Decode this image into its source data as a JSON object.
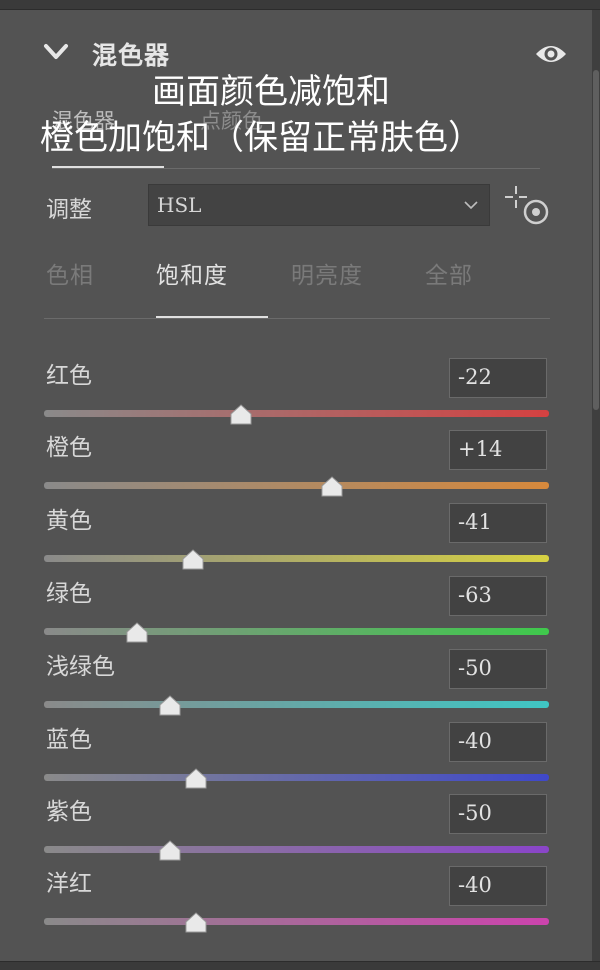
{
  "panel": {
    "title": "混色器"
  },
  "mode_tabs": {
    "mixer": "混色器",
    "point_color": "点颜色"
  },
  "overlay": {
    "line1": "画面颜色减饱和",
    "line2": "橙色加饱和（保留正常肤色）"
  },
  "adjust": {
    "label": "调整",
    "value": "HSL"
  },
  "subtabs": {
    "hue": "色相",
    "saturation": "饱和度",
    "luminance": "明亮度",
    "all": "全部"
  },
  "active_subtab": "饱和度",
  "sliders": [
    {
      "label": "红色",
      "display": "-22",
      "value": -22,
      "color": "#d44141"
    },
    {
      "label": "橙色",
      "display": "+14",
      "value": 14,
      "color": "#d7893c"
    },
    {
      "label": "黄色",
      "display": "-41",
      "value": -41,
      "color": "#d6d142"
    },
    {
      "label": "绿色",
      "display": "-63",
      "value": -63,
      "color": "#3fc94c"
    },
    {
      "label": "浅绿色",
      "display": "-50",
      "value": -50,
      "color": "#3fc6c4"
    },
    {
      "label": "蓝色",
      "display": "-40",
      "value": -40,
      "color": "#3f48c9"
    },
    {
      "label": "紫色",
      "display": "-50",
      "value": -50,
      "color": "#8a45c9"
    },
    {
      "label": "洋红",
      "display": "-40",
      "value": -40,
      "color": "#cc43ad"
    }
  ],
  "icons": [
    "chevron-down-icon",
    "eye-icon",
    "dropdown-caret-icon",
    "targeted-adjustment-icon"
  ]
}
